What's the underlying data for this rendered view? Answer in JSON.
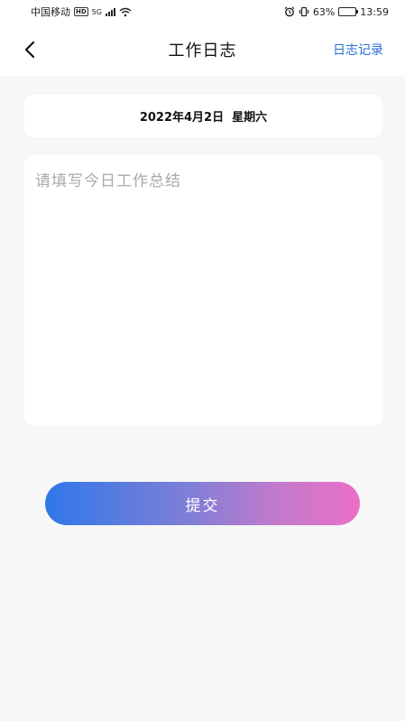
{
  "status_bar": {
    "carrier": "中国移动",
    "hd": "HD",
    "network": "5G",
    "battery": "63%",
    "battery_level": 0.63,
    "time": "13:59"
  },
  "nav": {
    "title": "工作日志",
    "action_label": "日志记录"
  },
  "date_card": {
    "date_text": "2022年4月2日  星期六"
  },
  "summary": {
    "placeholder": "请填写今日工作总结",
    "value": ""
  },
  "submit": {
    "label": "提交"
  },
  "colors": {
    "accent": "#2b6fd6",
    "gradient_start": "#2f78e9",
    "gradient_end": "#ea6fc6",
    "background": "#f7f7f8"
  }
}
